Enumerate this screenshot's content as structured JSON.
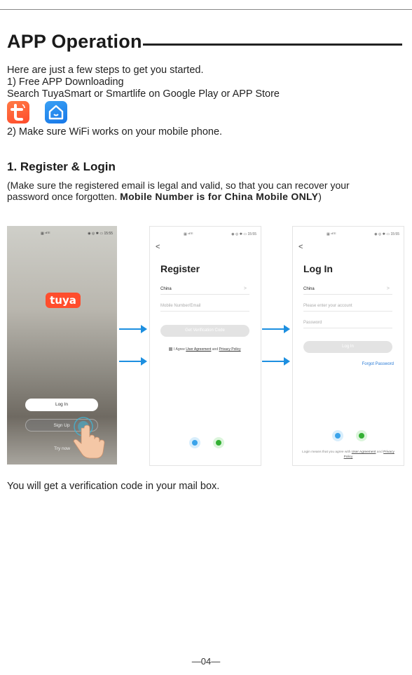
{
  "header": {
    "title": "APP Operation"
  },
  "intro": {
    "lines": [
      "Here are just a few steps to get you started.",
      "1) Free APP Downloading",
      "Search TuyaSmart or Smartlife on Google Play or APP Store"
    ],
    "step2": "2) Make sure WiFi works on your mobile phone."
  },
  "apps": [
    {
      "icon": "tuya-smart-app-icon",
      "color": "#ff5a36"
    },
    {
      "icon": "smart-life-app-icon",
      "color": "#1f86ee"
    }
  ],
  "section": {
    "title": "1. Register & Login",
    "note_plain": "(Make sure the registered email is legal and valid, so that you can recover your password once forgotten. ",
    "note_bold": "Mobile Number is for China Mobile ONLY",
    "note_end": ")"
  },
  "screens": {
    "status_left": "▦ ᵛᴵˡᵀᴱ",
    "status_right": "◉ ◎ ✱ ▭ 15:55",
    "welcome": {
      "logo": "tuya",
      "login": "Log In",
      "signup": "Sign Up",
      "try": "Try now"
    },
    "register": {
      "back": "<",
      "title": "Register",
      "country": "China",
      "chevron": ">",
      "account_placeholder": "Mobile Number/Email",
      "button": "Get Verification Code",
      "agree_prefix": "I Agree ",
      "agree_link1": "User Agreement",
      "agree_mid": " and ",
      "agree_link2": "Privacy Policy"
    },
    "login": {
      "back": "<",
      "title": "Log In",
      "country": "China",
      "chevron": ">",
      "account_placeholder": "Please enter your account",
      "password_placeholder": "Password",
      "button": "Log In",
      "forgot": "Forgot Password",
      "terms_prefix": "Login means that you agree with ",
      "terms_link1": "User Agreement",
      "terms_mid": " and ",
      "terms_link2": "Privacy Policy"
    }
  },
  "arrow_color": "#1d8fe0",
  "footer_text": "You will get a verification code in your mail box.",
  "page_number": "—04—"
}
